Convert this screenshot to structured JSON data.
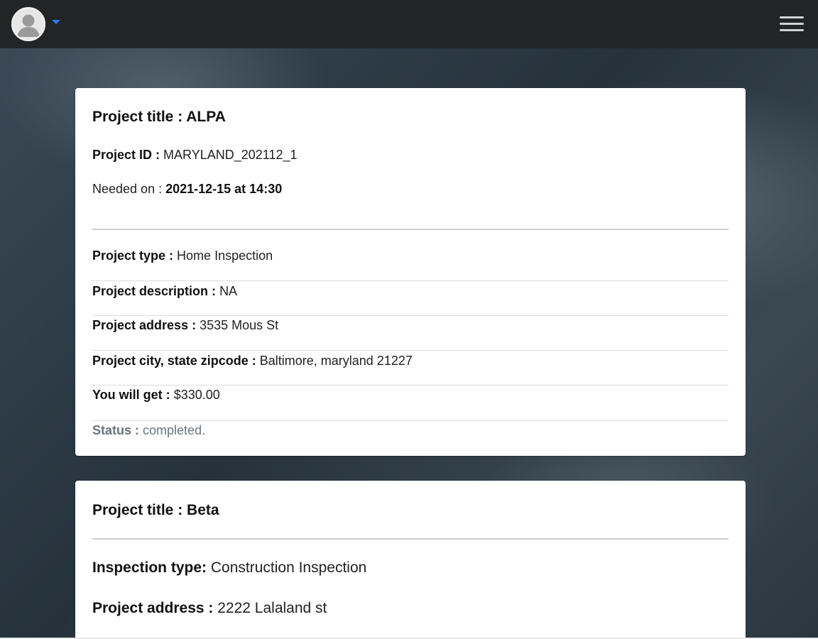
{
  "navbar": {
    "avatar_icon": "user-avatar-icon",
    "menu_icon": "hamburger-icon",
    "colors": {
      "bar": "#222426",
      "caret": "#2a7cf0"
    }
  },
  "projects": [
    {
      "title_label": "Project title :",
      "title_value": "ALPA",
      "id_label": "Project ID :",
      "id_value": "MARYLAND_202112_1",
      "needed_label": "Needed on :",
      "needed_value": "2021-12-15 at 14:30",
      "type_label": "Project type :",
      "type_value": "Home Inspection",
      "description_label": "Project description :",
      "description_value": "NA",
      "address_label": "Project address :",
      "address_value": "3535 Mous St",
      "city_label": "Project city, state zipcode :",
      "city_value": "Baltimore, maryland 21227",
      "pay_label": "You will get :",
      "pay_value": "$330.00",
      "status_label": "Status :",
      "status_value": "completed."
    },
    {
      "title_label": "Project title :",
      "title_value": "Beta",
      "inspection_label": "Inspection type:",
      "inspection_value": "Construction Inspection",
      "address_label": "Project address :",
      "address_value": "2222 Lalaland st"
    }
  ]
}
